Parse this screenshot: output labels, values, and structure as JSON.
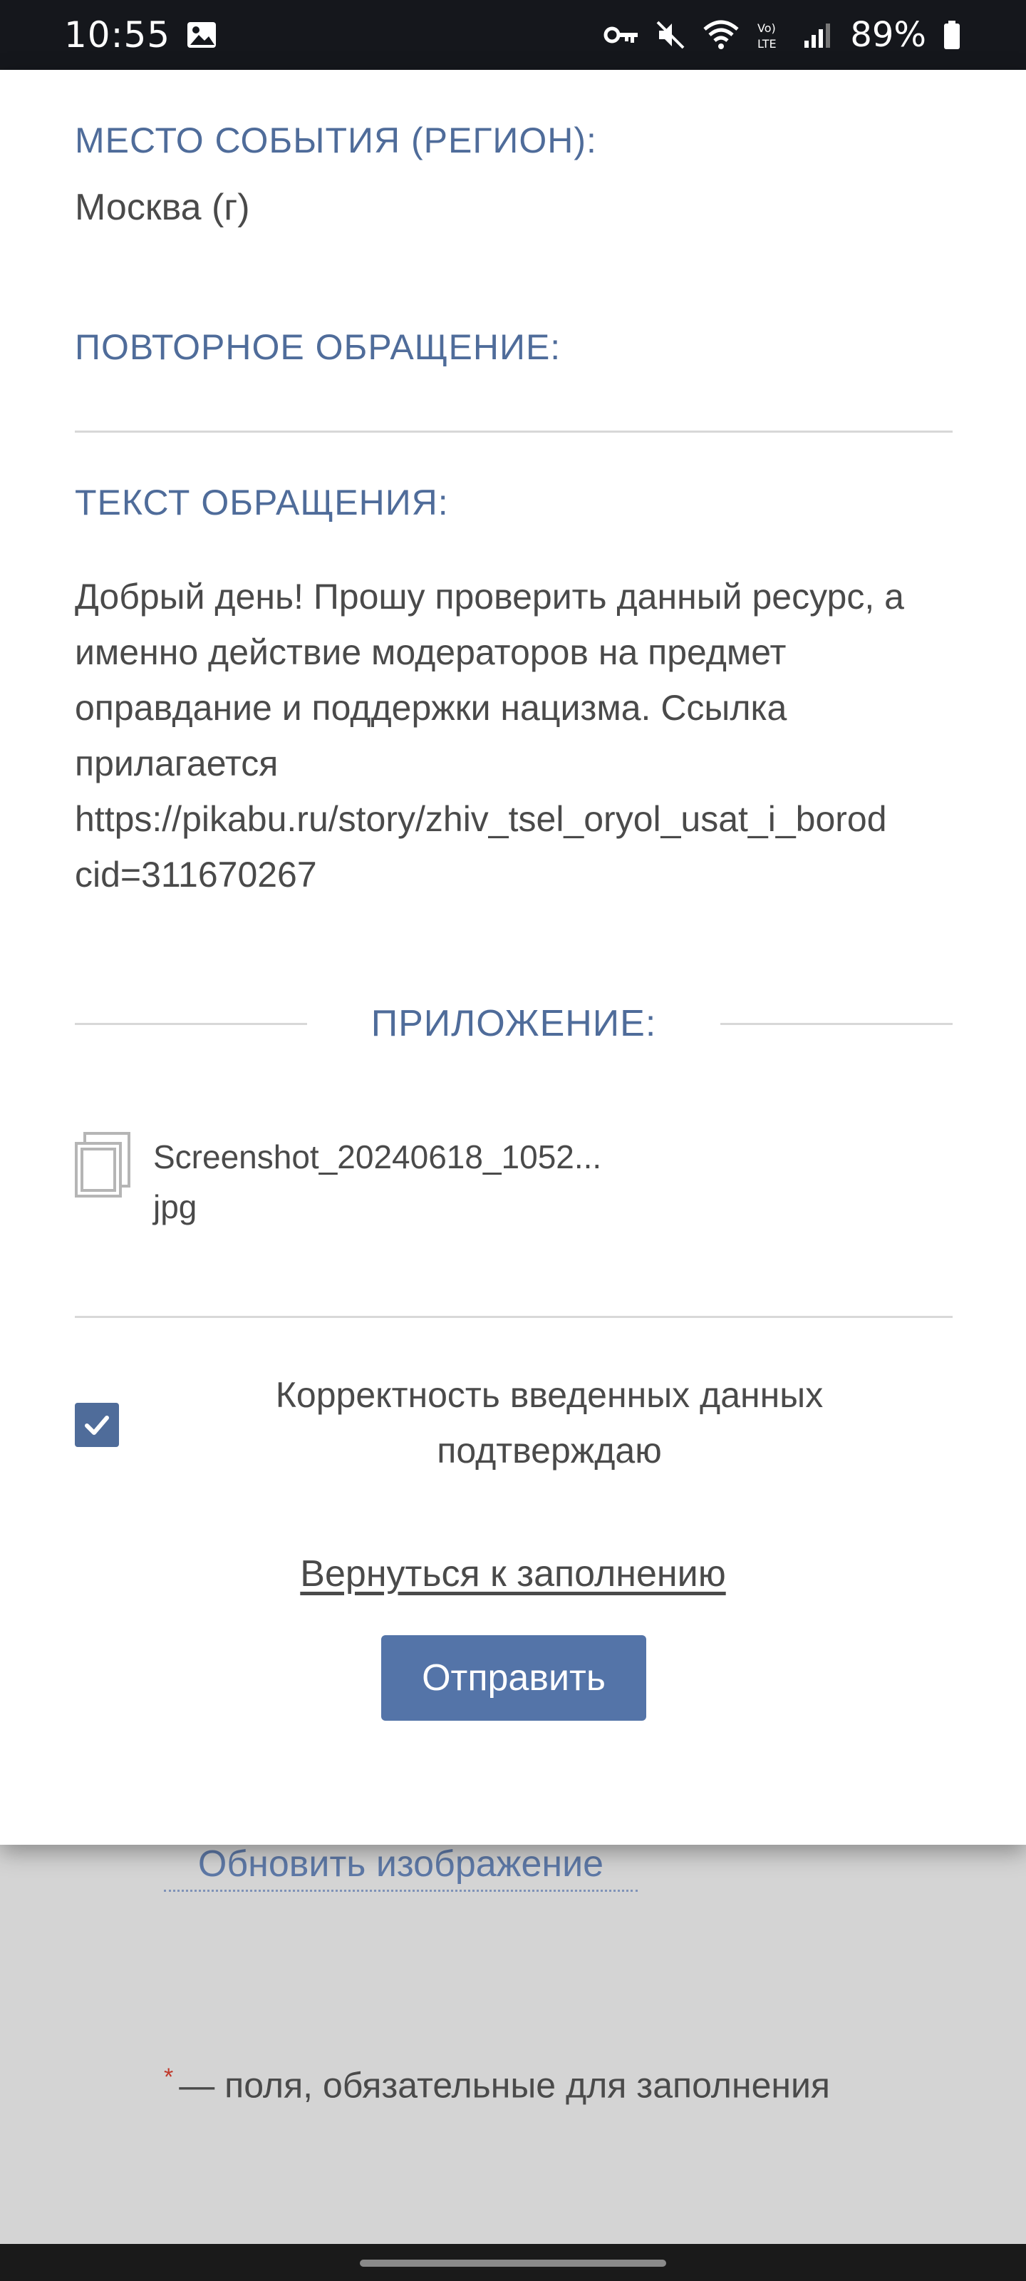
{
  "status_bar": {
    "time": "10:55",
    "battery": "89%",
    "icons": [
      "image-icon",
      "key-icon",
      "mute-icon",
      "wifi-icon",
      "volte-icon",
      "signal-icon",
      "battery-icon"
    ]
  },
  "modal": {
    "region_label": "МЕСТО СОБЫТИЯ (РЕГИОН):",
    "region_value": "Москва (г)",
    "repeat_label": "ПОВТОРНОЕ ОБРАЩЕНИЕ:",
    "text_label": "ТЕКСТ ОБРАЩЕНИЯ:",
    "appeal_lines": [
      "Добрый день! Прошу проверить данный ресурс, а",
      "именно действие модераторов на предмет",
      "оправдание и поддержки нацизма. Ссылка",
      "прилагается",
      "https://pikabu.ru/story/zhiv_tsel_oryol_usat_i_borod",
      "cid=311670267"
    ],
    "attachment_title": "ПРИЛОЖЕНИЕ:",
    "attachment_name_line1": "Screenshot_20240618_1052...",
    "attachment_name_line2": "jpg",
    "confirm_line1": "Корректность введенных данных",
    "confirm_line2": "подтверждаю",
    "back_link": "Вернуться к заполнению",
    "submit": "Отправить"
  },
  "background": {
    "refresh_link": "Обновить изображение",
    "required_star": "*",
    "required_note": "— поля, обязательные для заполнения"
  },
  "colors": {
    "accent": "#4f6c9a",
    "button": "#5474a8",
    "status_bar": "#15171c",
    "overlay": "#d4d4d4"
  }
}
